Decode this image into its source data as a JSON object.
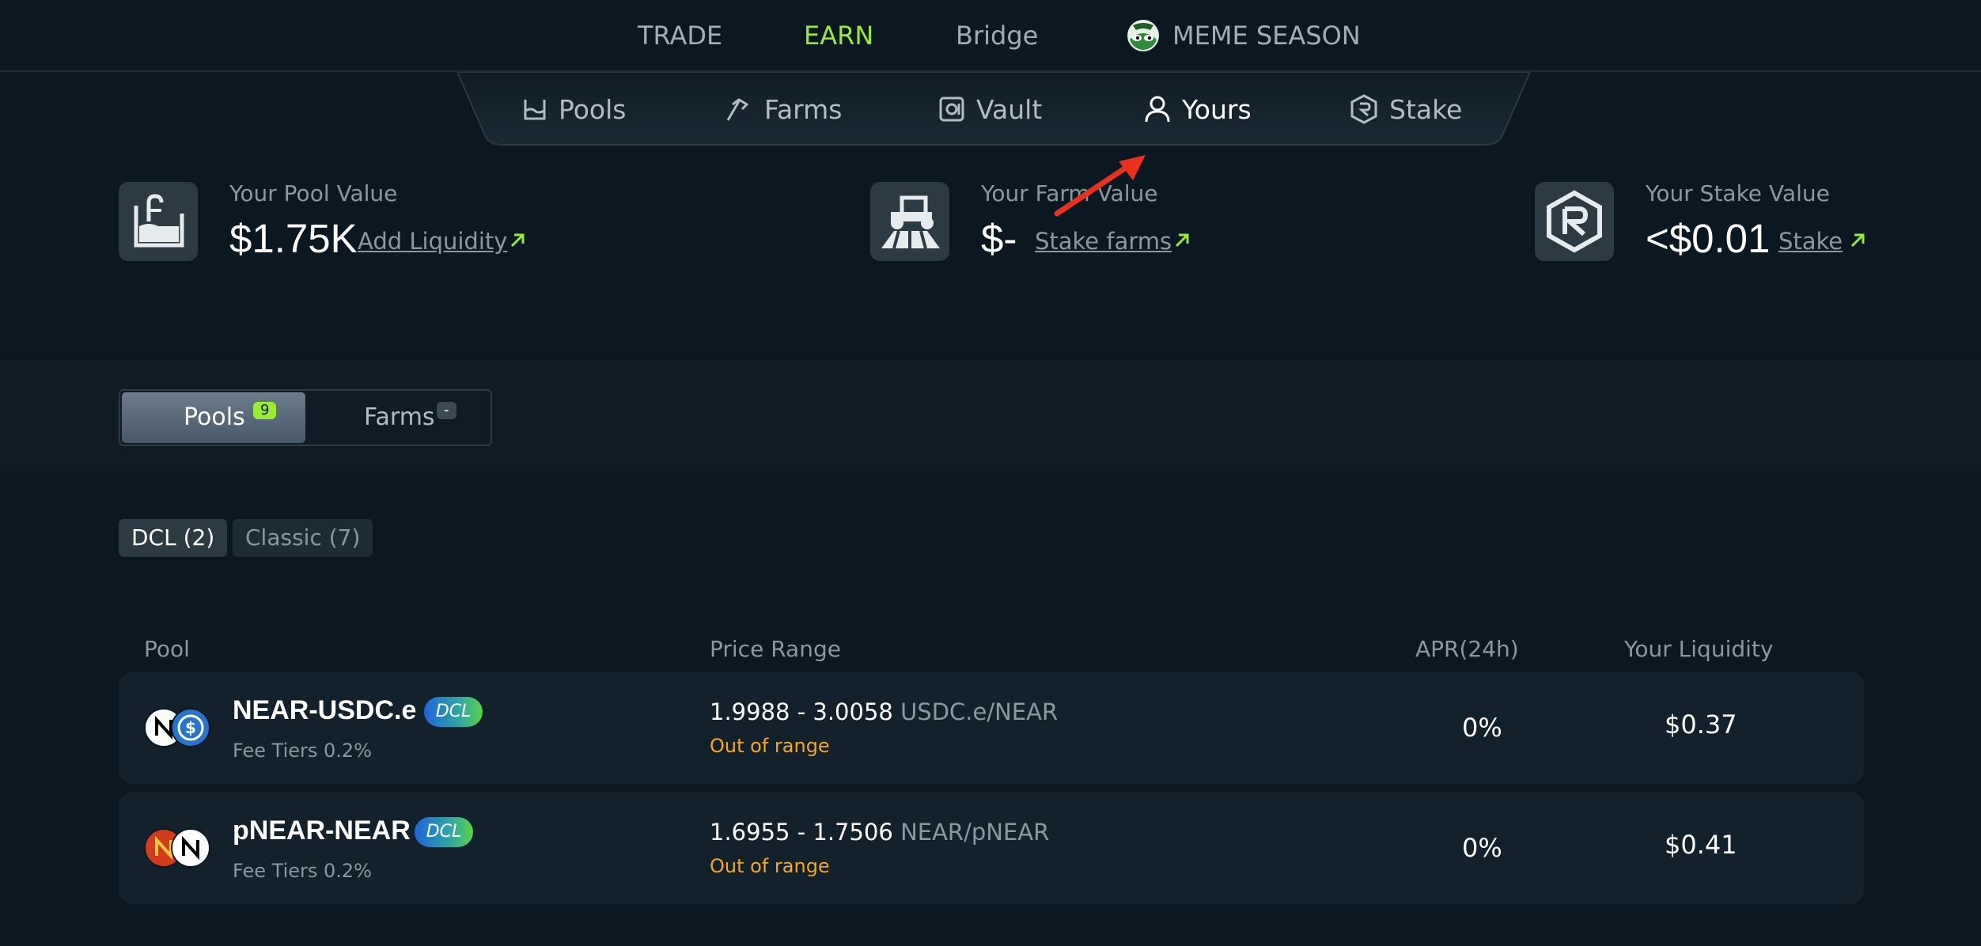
{
  "topnav": {
    "items": [
      {
        "label": "TRADE",
        "active": false
      },
      {
        "label": "EARN",
        "active": true
      },
      {
        "label": "Bridge",
        "active": false
      },
      {
        "label": "MEME SEASON",
        "active": false
      }
    ]
  },
  "subnav": {
    "items": [
      {
        "label": "Pools",
        "icon": "pool-icon",
        "active": false
      },
      {
        "label": "Farms",
        "icon": "farm-icon",
        "active": false
      },
      {
        "label": "Vault",
        "icon": "vault-icon",
        "active": false
      },
      {
        "label": "Yours",
        "icon": "user-icon",
        "active": true
      },
      {
        "label": "Stake",
        "icon": "stake-icon",
        "active": false
      }
    ]
  },
  "summary": {
    "pool": {
      "label": "Your Pool Value",
      "value": "$1.75K",
      "link": "Add Liquidity"
    },
    "farm": {
      "label": "Your Farm Value",
      "value": "$-",
      "link": "Stake farms"
    },
    "stake": {
      "label": "Your Stake Value",
      "value": "<$0.01",
      "link": "Stake"
    }
  },
  "toggle": {
    "pools": {
      "label": "Pools",
      "count": "9"
    },
    "farms": {
      "label": "Farms",
      "count": "-"
    }
  },
  "filters": {
    "dcl": "DCL (2)",
    "classic": "Classic (7)"
  },
  "table": {
    "headers": {
      "pool": "Pool",
      "range": "Price Range",
      "apr": "APR(24h)",
      "liquidity": "Your Liquidity"
    },
    "rows": [
      {
        "name": "NEAR-USDC.e",
        "badge": "DCL",
        "fee": "Fee Tiers 0.2%",
        "range": "1.9988 - 3.0058",
        "unit": "USDC.e/NEAR",
        "status": "Out of range",
        "apr": "0%",
        "liquidity": "$0.37"
      },
      {
        "name": "pNEAR-NEAR",
        "badge": "DCL",
        "fee": "Fee Tiers 0.2%",
        "range": "1.6955 - 1.7506",
        "unit": "NEAR/pNEAR",
        "status": "Out of range",
        "apr": "0%",
        "liquidity": "$0.41"
      }
    ]
  },
  "colors": {
    "background": "#0b1822",
    "accent": "#9aeb32",
    "warning": "#f5a623",
    "row": "#12212b"
  }
}
